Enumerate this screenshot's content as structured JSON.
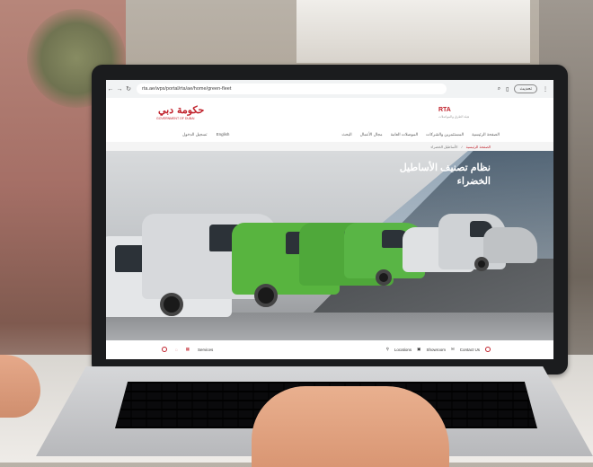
{
  "browser": {
    "url": "rta.ae/wps/portal/rta/ae/home/green-fleet",
    "profile_label": "تحديث"
  },
  "header": {
    "logo_left": "حكومة دبي",
    "logo_left_sub": "GOVERNMENT OF DUBAI",
    "logo_right": "RTA",
    "logo_right_sub": "هيئة الطرق والمواصلات"
  },
  "subnav": {
    "left_items": [
      "تسجيل الدخول",
      "English"
    ],
    "right_items": [
      "الصفحة الرئيسية",
      "المستثمرين والشركات",
      "الموصلات العامة",
      "مجال الأعمال",
      "البحث"
    ]
  },
  "breadcrumb": {
    "home": "الصفحة الرئيسية",
    "current": "الأساطيل الخضراء"
  },
  "hero": {
    "title_line1": "نظام تصنيف الأساطيل",
    "title_line2": "الخضراء"
  },
  "footer": {
    "left_label": "Services",
    "right_items": [
      "Locations",
      "Showroom",
      "Contact Us"
    ]
  },
  "colors": {
    "brand_red": "#c0202a",
    "fleet_green": "#52b043"
  }
}
